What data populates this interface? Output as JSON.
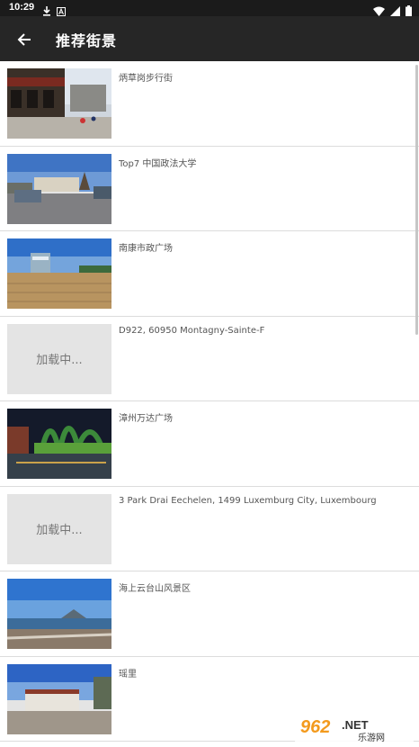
{
  "status_bar": {
    "time": "10:29",
    "icons_left": [
      "download-icon",
      "notification-a-icon"
    ],
    "icons_right": [
      "wifi-icon",
      "signal-icon",
      "battery-icon"
    ]
  },
  "app_bar": {
    "title": "推荐街景",
    "back_icon": "arrow-left-icon"
  },
  "items": [
    {
      "title": "炳草岗步行街",
      "loading": false
    },
    {
      "title": "Top7 中国政法大学",
      "loading": false
    },
    {
      "title": "南康市政广场",
      "loading": false
    },
    {
      "title": "D922, 60950 Montagny-Sainte-F",
      "loading": true,
      "loading_text": "加载中..."
    },
    {
      "title": "漳州万达广场",
      "loading": false
    },
    {
      "title": "3 Park Drai Eechelen, 1499 Luxemburg City, Luxembourg",
      "loading": true,
      "loading_text": "加载中..."
    },
    {
      "title": "海上云台山风景区",
      "loading": false
    },
    {
      "title": "瑶里",
      "loading": false
    }
  ],
  "watermark": {
    "number": "962",
    "suffix": ".NET",
    "cn": "乐游网"
  },
  "colors": {
    "status_bar": "#1b1b1b",
    "app_bar": "#262626",
    "loading_bg": "#e4e4e4",
    "watermark_orange": "#f39a1d"
  }
}
